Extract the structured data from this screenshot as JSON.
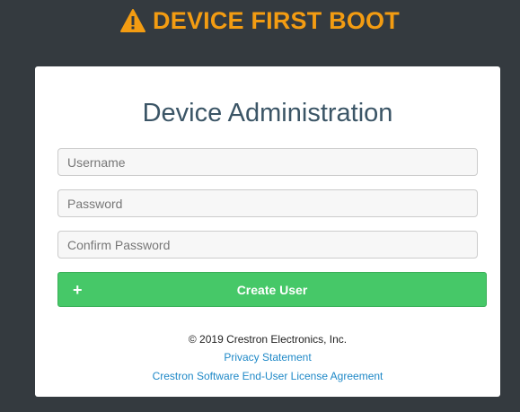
{
  "banner": {
    "icon": "warning-icon",
    "title": "DEVICE FIRST BOOT",
    "color": "#f39c12"
  },
  "card": {
    "title": "Device Administration",
    "fields": {
      "username": {
        "placeholder": "Username",
        "value": ""
      },
      "password": {
        "placeholder": "Password",
        "value": ""
      },
      "confirm_password": {
        "placeholder": "Confirm Password",
        "value": ""
      }
    },
    "create_button": {
      "icon": "plus-icon",
      "label": "Create User",
      "color": "#46c868"
    },
    "footer": {
      "copyright": "© 2019 Crestron Electronics, Inc.",
      "privacy_link": "Privacy Statement",
      "eula_link": "Crestron Software End-User License Agreement"
    }
  }
}
